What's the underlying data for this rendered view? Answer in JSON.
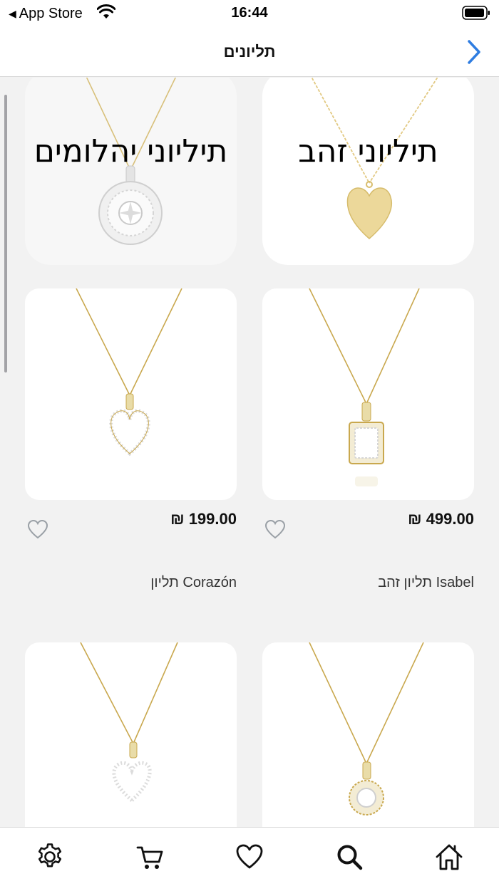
{
  "status_bar": {
    "back_app": "App Store",
    "time": "16:44"
  },
  "header": {
    "title": "תליונים"
  },
  "categories": [
    {
      "label": "תיליוני יהלומים"
    },
    {
      "label": "תיליוני זהב"
    }
  ],
  "products": [
    {
      "price": "₪ 199.00",
      "name": "תליון Corazón"
    },
    {
      "price": "₪ 499.00",
      "name": "תליון זהב Isabel"
    },
    {
      "price": "",
      "name": ""
    },
    {
      "price": "",
      "name": ""
    }
  ],
  "tab_bar": {
    "items": [
      {
        "icon": "gear-icon"
      },
      {
        "icon": "cart-icon"
      },
      {
        "icon": "heart-icon"
      },
      {
        "icon": "search-icon"
      },
      {
        "icon": "home-icon"
      }
    ]
  },
  "colors": {
    "accent": "#2f7de1",
    "gold": "#d4b25a",
    "background": "#f2f2f2"
  }
}
